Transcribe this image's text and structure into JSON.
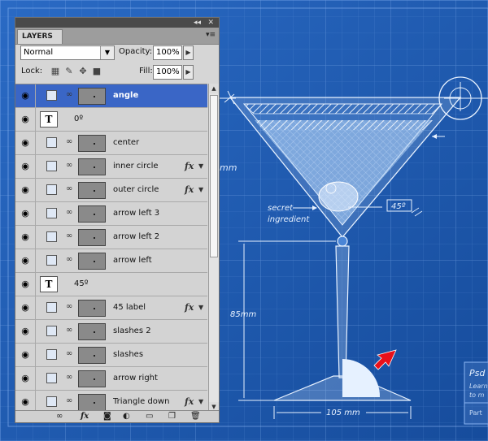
{
  "panel": {
    "tab_label": "LAYERS",
    "blend_mode": "Normal",
    "opacity_label": "Opacity:",
    "opacity_value": "100%",
    "lock_label": "Lock:",
    "fill_label": "Fill:",
    "fill_value": "100%"
  },
  "layers": [
    {
      "name": "angle",
      "kind": "shape",
      "selected": true,
      "fx": false
    },
    {
      "name": "0º",
      "kind": "text",
      "selected": false,
      "fx": false
    },
    {
      "name": "center",
      "kind": "shape",
      "selected": false,
      "fx": false
    },
    {
      "name": "inner circle",
      "kind": "shape",
      "selected": false,
      "fx": true
    },
    {
      "name": "outer circle",
      "kind": "shape",
      "selected": false,
      "fx": true
    },
    {
      "name": "arrow left 3",
      "kind": "shape",
      "selected": false,
      "fx": false
    },
    {
      "name": "arrow left 2",
      "kind": "shape",
      "selected": false,
      "fx": false
    },
    {
      "name": "arrow left",
      "kind": "shape",
      "selected": false,
      "fx": false
    },
    {
      "name": "45º",
      "kind": "text",
      "selected": false,
      "fx": false
    },
    {
      "name": "45 label",
      "kind": "shape",
      "selected": false,
      "fx": true
    },
    {
      "name": "slashes 2",
      "kind": "shape",
      "selected": false,
      "fx": false
    },
    {
      "name": "slashes",
      "kind": "shape",
      "selected": false,
      "fx": false
    },
    {
      "name": "arrow right",
      "kind": "shape",
      "selected": false,
      "fx": false
    },
    {
      "name": "Triangle down",
      "kind": "shape",
      "selected": false,
      "fx": true
    }
  ],
  "canvas": {
    "label_mm": "mm",
    "secret_line1": "secret",
    "secret_line2": "ingredient",
    "angle_label": "45º",
    "height_label": "85mm",
    "width_label": "105 mm",
    "side_title": "Psd",
    "side_line1": "Learn",
    "side_line2": "to m",
    "side_footer": "Part"
  },
  "colors": {
    "blueprint": "#1d5bb0",
    "selection": "#3a66c6",
    "arrow": "#e8101a"
  }
}
